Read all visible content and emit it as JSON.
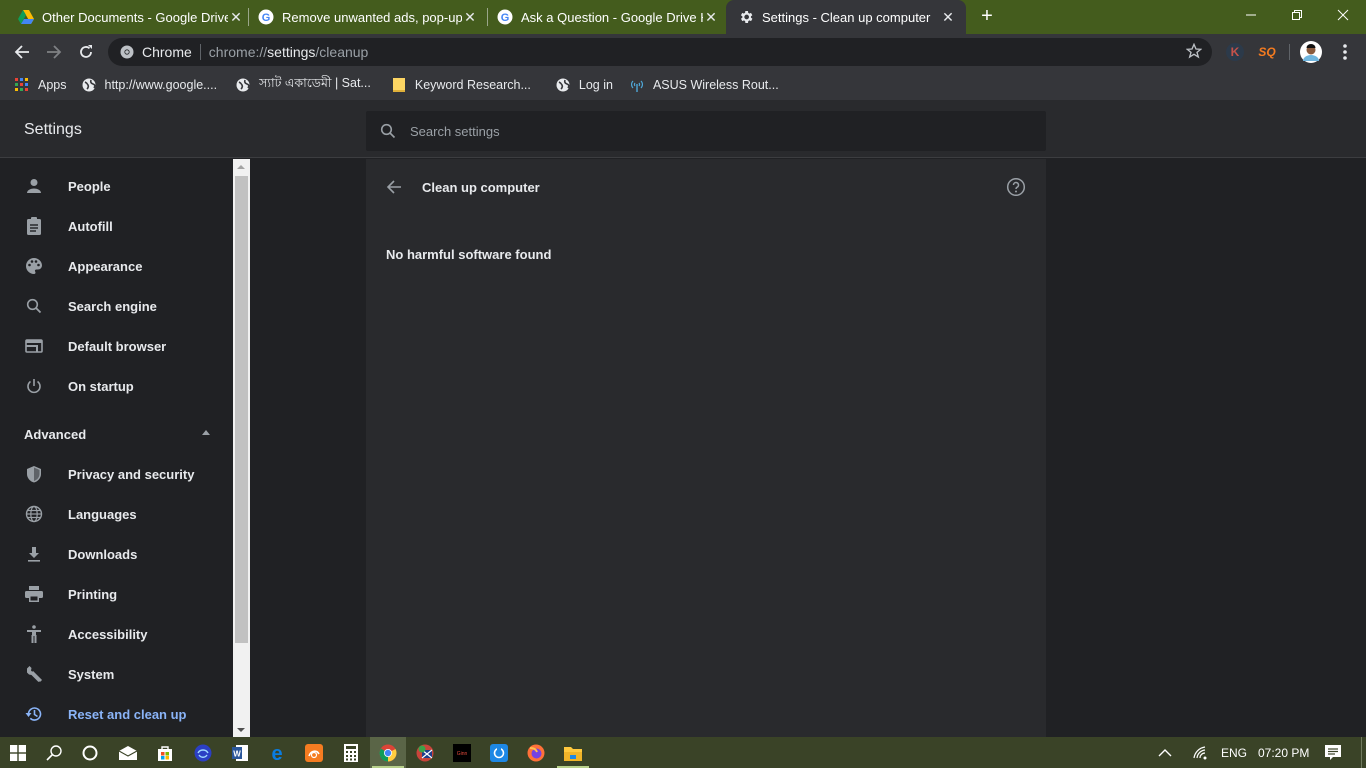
{
  "browser": {
    "tabs": [
      {
        "title": "Other Documents - Google Drive",
        "icon": "google-drive-icon",
        "active": false
      },
      {
        "title": "Remove unwanted ads, pop-ups",
        "icon": "google-icon",
        "active": false
      },
      {
        "title": "Ask a Question - Google Drive He",
        "icon": "google-icon",
        "active": false
      },
      {
        "title": "Settings - Clean up computer",
        "icon": "gear-icon",
        "active": true
      }
    ],
    "new_tab_label": "+",
    "omnibox": {
      "chip": "Chrome",
      "url_prefix": "chrome://",
      "url_host": "settings",
      "url_path": "/cleanup"
    },
    "extensions": [
      {
        "name": "K",
        "color": "#c5524a"
      },
      {
        "name": "SQ",
        "color": "#f47b20"
      }
    ],
    "bookmarks": [
      {
        "label": "Apps",
        "icon": "apps-grid-icon"
      },
      {
        "label": "http://www.google....",
        "icon": "globe-icon"
      },
      {
        "label": "স্যাট একাডেমী | Sat...",
        "icon": "globe-icon"
      },
      {
        "label": "Keyword Research...",
        "icon": "folder-icon"
      },
      {
        "label": "Log in",
        "icon": "globe-icon"
      },
      {
        "label": "ASUS Wireless Rout...",
        "icon": "wireless-router-icon"
      }
    ]
  },
  "settings": {
    "title": "Settings",
    "search_placeholder": "Search settings",
    "nav": [
      {
        "label": "People",
        "icon": "person-icon"
      },
      {
        "label": "Autofill",
        "icon": "clipboard-icon"
      },
      {
        "label": "Appearance",
        "icon": "palette-icon"
      },
      {
        "label": "Search engine",
        "icon": "search-icon"
      },
      {
        "label": "Default browser",
        "icon": "browser-window-icon"
      },
      {
        "label": "On startup",
        "icon": "power-icon"
      }
    ],
    "advanced_label": "Advanced",
    "advanced_nav": [
      {
        "label": "Privacy and security",
        "icon": "shield-icon"
      },
      {
        "label": "Languages",
        "icon": "globe-icon"
      },
      {
        "label": "Downloads",
        "icon": "download-icon"
      },
      {
        "label": "Printing",
        "icon": "printer-icon"
      },
      {
        "label": "Accessibility",
        "icon": "accessibility-icon"
      },
      {
        "label": "System",
        "icon": "wrench-icon"
      },
      {
        "label": "Reset and clean up",
        "icon": "history-icon",
        "active": true
      }
    ],
    "page": {
      "title": "Clean up computer",
      "status": "No harmful software found"
    }
  },
  "taskbar": {
    "apps": [
      "start",
      "search",
      "cortana",
      "mail",
      "store",
      "app-blue",
      "word",
      "edge",
      "uc-browser",
      "calculator",
      "chrome",
      "app-flag",
      "app-dark",
      "app-sync",
      "firefox",
      "file-explorer"
    ],
    "language": "ENG",
    "time": "07:20 PM"
  },
  "colors": {
    "titlebar": "#445c1d",
    "accent": "#8ab4f8",
    "taskbar": "#3a4327"
  }
}
